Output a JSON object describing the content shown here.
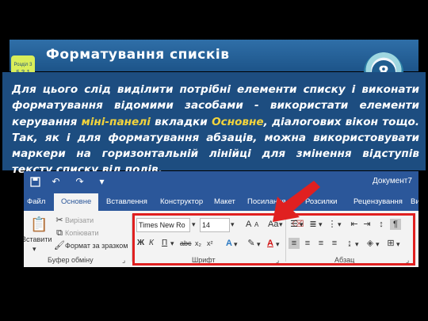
{
  "slide": {
    "title": "Форматування списків",
    "section_badge": {
      "line1": "Розділ 3",
      "line2": "§ 3.1"
    },
    "grade": "8",
    "body_part1": "Для цього слід виділити потрібні елементи списку і виконати форматування відомими засобами - використати елементи керування ",
    "body_highlight1": "міні-панелі",
    "body_part2": " вкладки ",
    "body_highlight2": "Основне",
    "body_part3": ", діалогових вікон тощо. Так, як і для форматування абзаців, можна використовувати маркери на горизонтальній лінійці для змінення відступів тексту списку від полів."
  },
  "word": {
    "doc_title": "Документ7",
    "tabs": [
      "Файл",
      "Основне",
      "Вставлення",
      "Конструктор",
      "Макет",
      "Посилання",
      "Розсилки",
      "Рецензування",
      "Вигл"
    ],
    "active_tab": "Основне",
    "paste_label": "Вставити",
    "cut_label": "Вирізати",
    "copy_label": "Копіювати",
    "format_painter_label": "Формат за зразком",
    "clipboard_group": "Буфер обміну",
    "font_name": "Times New Ro",
    "font_size": "14",
    "font_group": "Шрифт",
    "paragraph_group": "Абзац",
    "bold": "Ж",
    "italic": "К",
    "underline": "П",
    "strikethrough": "abc",
    "subscript": "x₂",
    "superscript": "x²",
    "change_case": "Aa",
    "grow_font": "A",
    "shrink_font": "A"
  },
  "colors": {
    "word_blue": "#2b579a",
    "highlight_text": "#f2d43c",
    "callout_red": "#e02020",
    "panel_blue": "#1d4d80"
  },
  "icons": [
    "save-icon",
    "undo-icon",
    "redo-icon",
    "cut-icon",
    "copy-icon",
    "format-painter-icon",
    "arrow-icon"
  ]
}
